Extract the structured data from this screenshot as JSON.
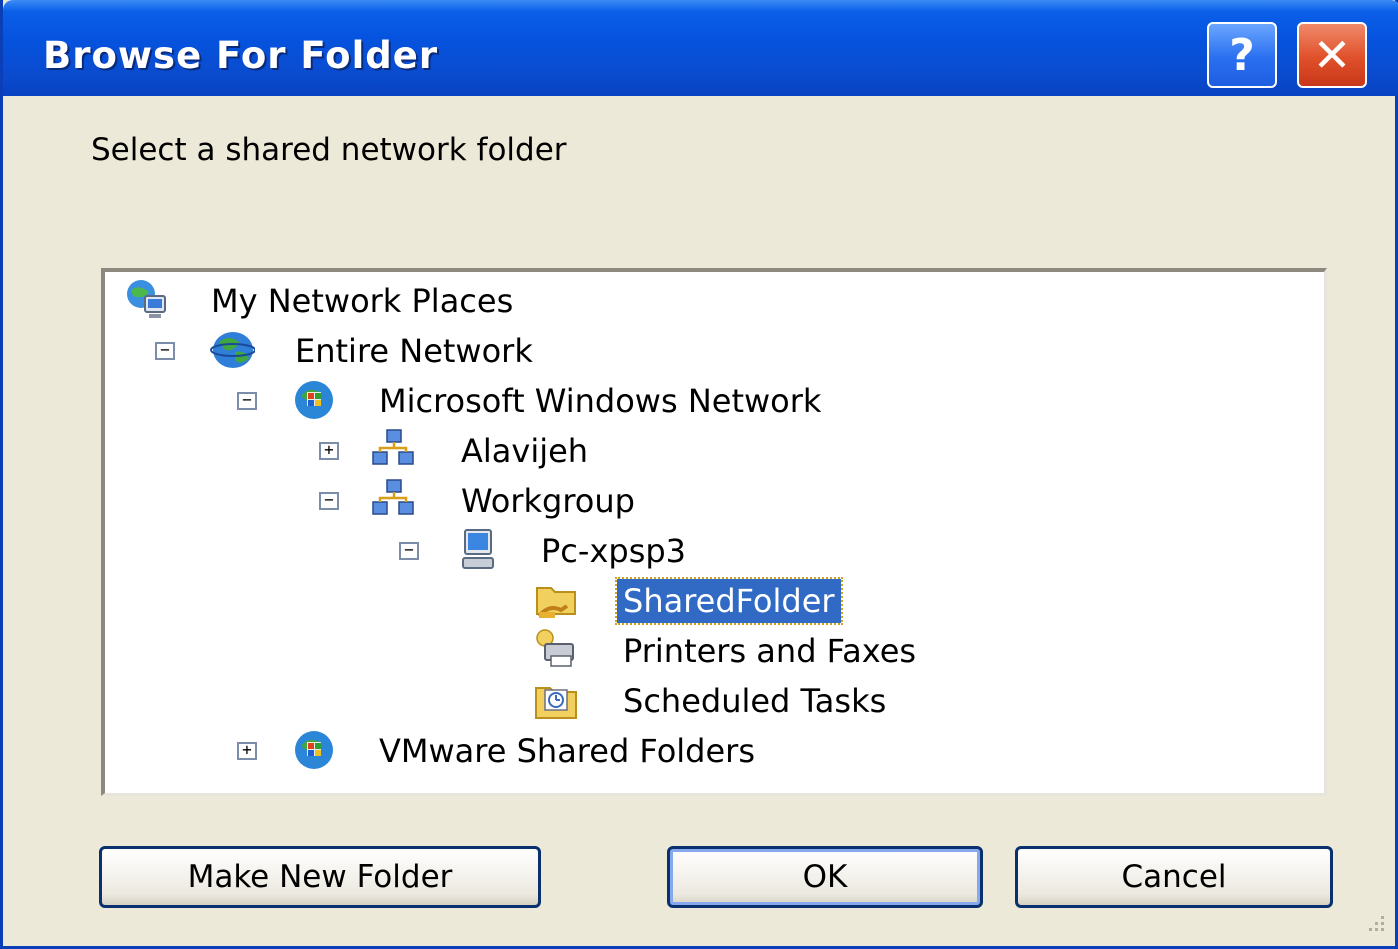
{
  "window": {
    "title": "Browse For Folder",
    "help_label": "?",
    "close_label": "✕"
  },
  "prompt": "Select a shared network folder",
  "tree": {
    "items": [
      {
        "label": "My Network Places",
        "expander": "",
        "icon": "network-places-icon"
      },
      {
        "label": "Entire Network",
        "expander": "−",
        "icon": "globe-icon"
      },
      {
        "label": "Microsoft Windows Network",
        "expander": "−",
        "icon": "windows-network-icon"
      },
      {
        "label": "Alavijeh",
        "expander": "+",
        "icon": "workgroup-icon"
      },
      {
        "label": "Workgroup",
        "expander": "−",
        "icon": "workgroup-icon"
      },
      {
        "label": "Pc-xpsp3",
        "expander": "−",
        "icon": "computer-icon"
      },
      {
        "label": "SharedFolder",
        "expander": "",
        "icon": "shared-folder-icon",
        "selected": true
      },
      {
        "label": "Printers and Faxes",
        "expander": "",
        "icon": "printer-icon"
      },
      {
        "label": "Scheduled Tasks",
        "expander": "",
        "icon": "scheduled-tasks-icon"
      },
      {
        "label": "VMware Shared Folders",
        "expander": "+",
        "icon": "windows-network-icon"
      }
    ]
  },
  "buttons": {
    "make_new_folder": "Make New Folder",
    "ok": "OK",
    "cancel": "Cancel"
  },
  "colors": {
    "title_blue": "#0553de",
    "selection": "#316ac5",
    "dialog_bg": "#ece9d8"
  }
}
